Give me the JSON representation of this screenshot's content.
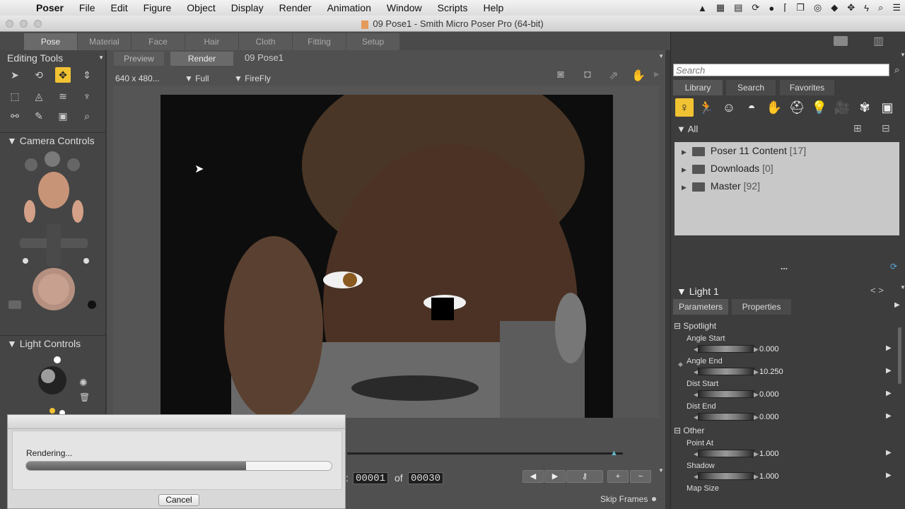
{
  "menubar": {
    "app": "Poser",
    "items": [
      "File",
      "Edit",
      "Figure",
      "Object",
      "Display",
      "Render",
      "Animation",
      "Window",
      "Scripts",
      "Help"
    ]
  },
  "window": {
    "title": "09 Pose1 - Smith Micro Poser Pro  (64-bit)"
  },
  "rooms": [
    "Pose",
    "Material",
    "Face",
    "Hair",
    "Cloth",
    "Fitting",
    "Setup"
  ],
  "active_room": "Pose",
  "left_panel": {
    "editing_tools": "Editing Tools",
    "camera_controls": "Camera Controls",
    "light_controls": "Light Controls"
  },
  "document": {
    "tabs": [
      "Preview",
      "Render"
    ],
    "active_tab": "Render",
    "name": "09 Pose1",
    "resolution": "640 x 480...",
    "quality": "Full",
    "engine": "FireFly"
  },
  "library": {
    "search_placeholder": "Search",
    "tabs": [
      "Library",
      "Search",
      "Favorites"
    ],
    "active_tab": "Library",
    "filter": "All",
    "folders": [
      {
        "name": "Poser 11 Content",
        "count": "[17]"
      },
      {
        "name": "Downloads",
        "count": "[0]"
      },
      {
        "name": "Master",
        "count": "[92]"
      }
    ],
    "more": "..."
  },
  "properties": {
    "object": "Light 1",
    "tabs": [
      "Parameters",
      "Properties"
    ],
    "active_tab": "Parameters",
    "groups": [
      {
        "name": "Spotlight",
        "params": [
          {
            "label": "Angle Start",
            "value": "0.000"
          },
          {
            "label": "Angle End",
            "value": "10.250"
          },
          {
            "label": "Dist Start",
            "value": "0.000"
          },
          {
            "label": "Dist End",
            "value": "0.000"
          }
        ]
      },
      {
        "name": "Other",
        "params": [
          {
            "label": "Point At",
            "value": "1.000"
          },
          {
            "label": "Shadow",
            "value": "1.000"
          },
          {
            "label": "Map Size",
            "value": ""
          }
        ]
      }
    ]
  },
  "timeline": {
    "current_frame": "00001",
    "of_label": "of",
    "total_frames": "00030",
    "skip_frames": "Skip Frames"
  },
  "render_dialog": {
    "status": "Rendering...",
    "progress": 0.72,
    "cancel": "Cancel"
  },
  "colors": {
    "accent": "#f1c232",
    "panel": "#454545"
  },
  "tray_icons": [
    "adobe-icon",
    "chart-icon",
    "calendar-icon",
    "sync-icon",
    "steam-icon",
    "bracket-icon",
    "copy-icon",
    "cc-icon",
    "dropbox-icon",
    "move-icon",
    "flash-icon",
    "search-icon",
    "list-icon"
  ]
}
